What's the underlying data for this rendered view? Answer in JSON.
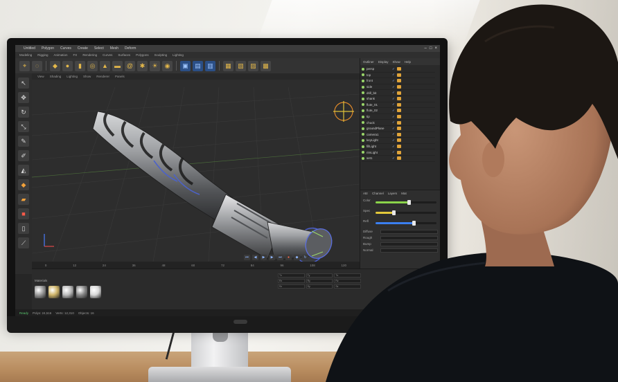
{
  "scene": {
    "description_colors": {
      "wall": "#f1efea",
      "desk": "#c09366",
      "shirt": "#101318",
      "hair": "#1c1713",
      "skin": "#b98468"
    }
  },
  "app": {
    "menu": [
      "Untitled",
      "Polygon",
      "Curves",
      "Create",
      "Select",
      "Mesh",
      "Deform"
    ],
    "toolbar": [
      "Modeling",
      "Rigging",
      "Animation",
      "FX",
      "Rendering",
      "Curves",
      "Surfaces",
      "Polygons",
      "Sculpting",
      "Lighting"
    ],
    "viewport_tabs": [
      "View",
      "Shading",
      "Lighting",
      "Show",
      "Renderer",
      "Panels"
    ],
    "right_tabs": [
      "Outliner",
      "Display",
      "Show",
      "Help"
    ],
    "scene_items": [
      "persp",
      "top",
      "front",
      "side",
      "drill_bit",
      "shank",
      "flute_01",
      "flute_02",
      "tip",
      "chuck",
      "groundPlane",
      "camera1",
      "keyLight",
      "fillLight",
      "rimLight",
      "set1"
    ],
    "attr_tabs": [
      "Attr",
      "Channel",
      "Layers",
      "Mat"
    ],
    "attr_sliders": [
      {
        "label": "Color",
        "value": 0.55,
        "color": "#8bd44a"
      },
      {
        "label": "Spec",
        "value": 0.3,
        "color": "#e3c83a"
      },
      {
        "label": "Refl",
        "value": 0.62,
        "color": "#3b7ff0"
      }
    ],
    "attr_fields": [
      "Diffuse",
      "Rough",
      "Bump",
      "Normal"
    ],
    "timeline_ticks": [
      "0",
      "12",
      "24",
      "36",
      "48",
      "60",
      "72",
      "84",
      "96",
      "108",
      "120"
    ],
    "materials_label": "Materials",
    "materials": [
      "#9a9a9a",
      "#cfb56a",
      "#bcbcbc",
      "#8a8a8a",
      "#d8d8d8"
    ],
    "props": [
      "Tx",
      "Ty",
      "Tz",
      "Rx",
      "Ry",
      "Rz",
      "Sx",
      "Sy",
      "Sz"
    ],
    "status": [
      "Ready",
      "Polys: 24,516",
      "Verts: 12,310",
      "Objects: 16"
    ]
  }
}
